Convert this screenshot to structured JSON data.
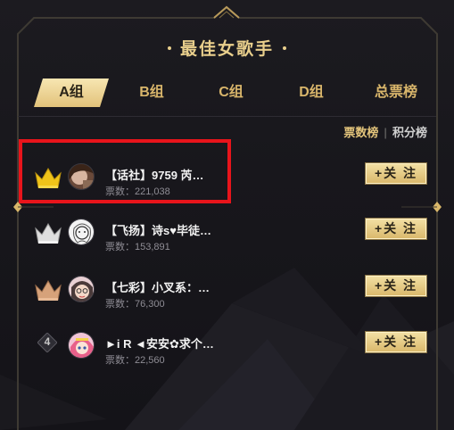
{
  "title": "最佳女歌手",
  "tabs": [
    {
      "label": "A组",
      "active": true
    },
    {
      "label": "B组",
      "active": false
    },
    {
      "label": "C组",
      "active": false
    },
    {
      "label": "D组",
      "active": false
    },
    {
      "label": "总票榜",
      "active": false
    }
  ],
  "subtabs": {
    "votes_label": "票数榜",
    "points_label": "积分榜",
    "separator": "|"
  },
  "rows": [
    {
      "rank": "1",
      "rank_icon": "gold-crown-icon",
      "name": "【话社】9759 芮…",
      "votes": "票数：221,038",
      "follow": "+关 注"
    },
    {
      "rank": "2",
      "rank_icon": "silver-crown-icon",
      "name": "【飞扬】诗s♥毕徒…",
      "votes": "票数：153,891",
      "follow": "+关 注"
    },
    {
      "rank": "3",
      "rank_icon": "bronze-crown-icon",
      "name": "【七彩】小叉系：…",
      "votes": "票数：76,300",
      "follow": "+关 注"
    },
    {
      "rank": "4",
      "rank_icon": "rank-badge-icon",
      "name": "►i R ◄安安✿求个…",
      "votes": "票数：22,560",
      "follow": "+关 注"
    }
  ],
  "colors": {
    "accent": "#e3c47b",
    "highlight": "#e8141b",
    "gold": "#f0c419",
    "silver": "#dedede",
    "bronze": "#d6a27a"
  }
}
